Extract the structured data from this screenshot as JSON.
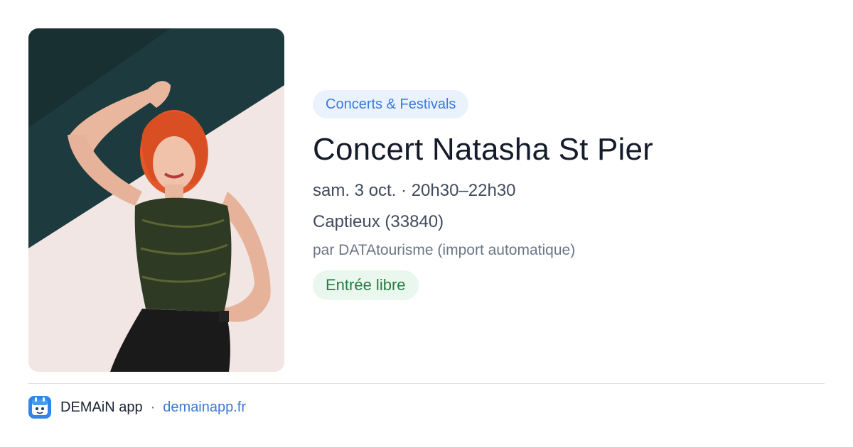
{
  "event": {
    "category": "Concerts & Festivals",
    "title": "Concert Natasha St Pier",
    "datetime": "sam. 3 oct. · 20h30–22h30",
    "location": "Captieux (33840)",
    "source": "par DATAtourisme (import automatique)",
    "price": "Entrée libre"
  },
  "footer": {
    "app_name": "DEMAiN app",
    "separator": "·",
    "link": "demainapp.fr"
  },
  "colors": {
    "accent_blue": "#3b7ad9",
    "category_bg": "#eaf2fd",
    "price_green": "#2b7a43",
    "price_bg": "#eaf7ee"
  },
  "icons": {
    "app_logo": "demain-app-logo-icon"
  }
}
